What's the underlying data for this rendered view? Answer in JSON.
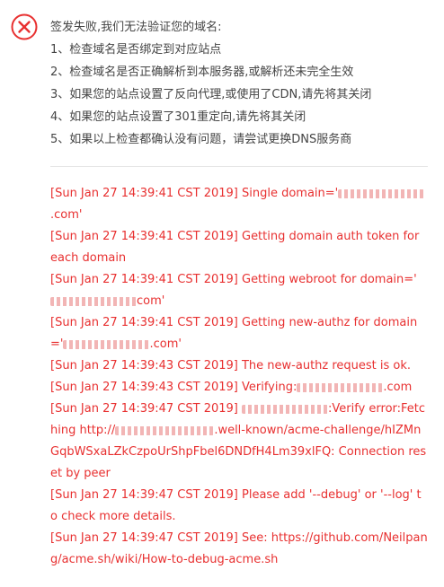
{
  "dialog": {
    "title": "签发失败,我们无法验证您的域名:",
    "icon": "close-circle-icon",
    "accent_color": "#e83030",
    "checks": [
      "1、检查域名是否绑定到对应站点",
      "2、检查域名是否正确解析到本服务器,或解析还未完全生效",
      "3、如果您的站点设置了反向代理,或使用了CDN,请先将其关闭",
      "4、如果您的站点设置了301重定向,请先将其关闭",
      "5、如果以上检查都确认没有问题，请尝试更换DNS服务商"
    ]
  },
  "log": [
    {
      "prefix": "[Sun Jan 27 14:39:41 CST 2019] Single domain='",
      "suffix": ".com'"
    },
    {
      "prefix": "[Sun Jan 27 14:39:41 CST 2019] Getting domain auth token for each domain",
      "suffix": ""
    },
    {
      "prefix": "[Sun Jan 27 14:39:41 CST 2019] Getting webroot for domain='",
      "suffix": "com'"
    },
    {
      "prefix": "[Sun Jan 27 14:39:41 CST 2019] Getting new-authz for domain='",
      "suffix": ".com'"
    },
    {
      "prefix": "[Sun Jan 27 14:39:43 CST 2019] The new-authz request is ok.",
      "suffix": ""
    },
    {
      "prefix": "[Sun Jan 27 14:39:43 CST 2019] Verifying:",
      "suffix": ".com"
    },
    {
      "prefix": "[Sun Jan 27 14:39:47 CST 2019] ",
      "suffix": ":Verify error:Fetching http://"
    },
    {
      "prefix": "",
      "suffix": ".well-known/acme-challenge/hIZMnGqbWSxaLZkCzpoUrShpFbel6DNDfH4Lm39xlFQ: Connection reset by peer"
    },
    {
      "prefix": "[Sun Jan 27 14:39:47 CST 2019] Please add '--debug' or '--log' to check more details.",
      "suffix": ""
    },
    {
      "prefix": "[Sun Jan 27 14:39:47 CST 2019] See: https://github.com/Neilpang/acme.sh/wiki/How-to-debug-acme.sh",
      "suffix": ""
    }
  ]
}
